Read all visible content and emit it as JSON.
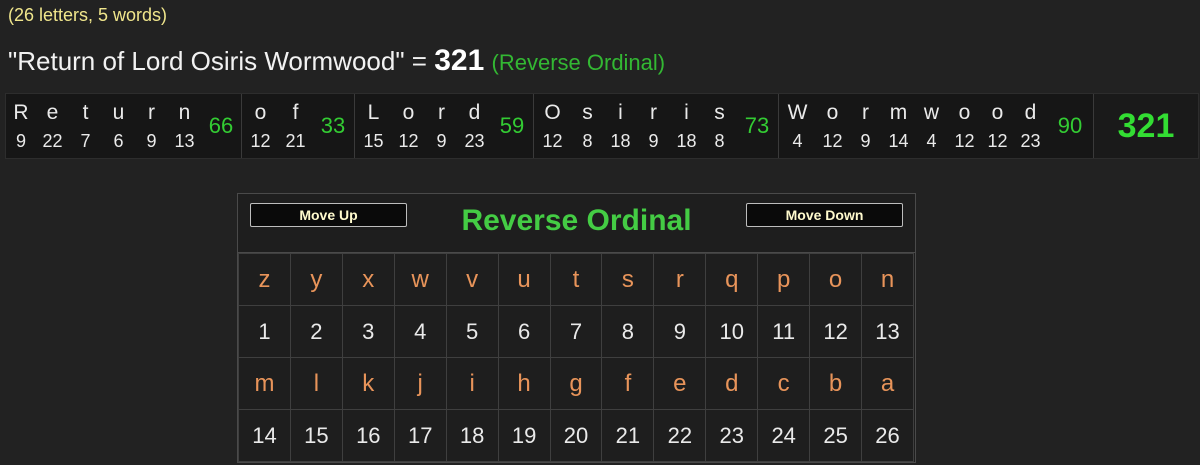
{
  "summary": {
    "counts": "(26 letters, 5 words)"
  },
  "phrase": {
    "text": "\"Return of Lord Osiris Wormwood\"",
    "equals": "=",
    "total": "321",
    "cipher": "(Reverse Ordinal)"
  },
  "breakdown": {
    "words": [
      {
        "letters": [
          "R",
          "e",
          "t",
          "u",
          "r",
          "n"
        ],
        "values": [
          "9",
          "22",
          "7",
          "6",
          "9",
          "13"
        ],
        "sum": "66"
      },
      {
        "letters": [
          "o",
          "f"
        ],
        "values": [
          "12",
          "21"
        ],
        "sum": "33"
      },
      {
        "letters": [
          "L",
          "o",
          "r",
          "d"
        ],
        "values": [
          "15",
          "12",
          "9",
          "23"
        ],
        "sum": "59"
      },
      {
        "letters": [
          "O",
          "s",
          "i",
          "r",
          "i",
          "s"
        ],
        "values": [
          "12",
          "8",
          "18",
          "9",
          "18",
          "8"
        ],
        "sum": "73"
      },
      {
        "letters": [
          "W",
          "o",
          "r",
          "m",
          "w",
          "o",
          "o",
          "d"
        ],
        "values": [
          "4",
          "12",
          "9",
          "14",
          "4",
          "12",
          "12",
          "23"
        ],
        "sum": "90"
      }
    ],
    "grand_total": "321"
  },
  "cipher_panel": {
    "move_up_label": "Move Up",
    "move_down_label": "Move Down",
    "title": "Reverse Ordinal",
    "rows": [
      {
        "letters": [
          "z",
          "y",
          "x",
          "w",
          "v",
          "u",
          "t",
          "s",
          "r",
          "q",
          "p",
          "o",
          "n"
        ],
        "values": [
          "1",
          "2",
          "3",
          "4",
          "5",
          "6",
          "7",
          "8",
          "9",
          "10",
          "11",
          "12",
          "13"
        ]
      },
      {
        "letters": [
          "m",
          "l",
          "k",
          "j",
          "i",
          "h",
          "g",
          "f",
          "e",
          "d",
          "c",
          "b",
          "a"
        ],
        "values": [
          "14",
          "15",
          "16",
          "17",
          "18",
          "19",
          "20",
          "21",
          "22",
          "23",
          "24",
          "25",
          "26"
        ]
      }
    ]
  },
  "colors": {
    "background": "#222222",
    "accent_green": "#33cc33",
    "letter_orange": "#e8945a",
    "count_yellow": "#f0e68c"
  }
}
